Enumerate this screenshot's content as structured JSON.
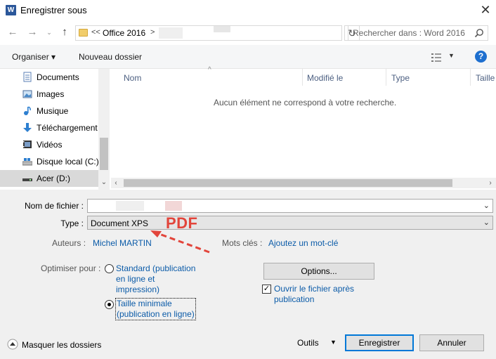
{
  "window": {
    "title": "Enregistrer sous",
    "app_icon_letter": "W"
  },
  "nav": {
    "address_prefix": "<<",
    "address_folder": "Office 2016",
    "address_chevron": ">",
    "search_placeholder": "Rechercher dans : Word 2016"
  },
  "toolbar": {
    "organize_label": "Organiser ▾",
    "new_folder_label": "Nouveau dossier"
  },
  "sidebar": {
    "items": [
      {
        "label": "Documents",
        "icon": "documents-icon",
        "selected": false
      },
      {
        "label": "Images",
        "icon": "images-icon",
        "selected": false
      },
      {
        "label": "Musique",
        "icon": "music-icon",
        "selected": false
      },
      {
        "label": "Téléchargement",
        "icon": "download-icon",
        "selected": false
      },
      {
        "label": "Vidéos",
        "icon": "videos-icon",
        "selected": false
      },
      {
        "label": "Disque local (C:)",
        "icon": "local-disk-icon",
        "selected": false
      },
      {
        "label": "Acer (D:)",
        "icon": "drive-icon",
        "selected": true
      }
    ]
  },
  "file_list": {
    "columns": [
      "Nom",
      "Modifié le",
      "Type",
      "Taille"
    ],
    "empty_message": "Aucun élément ne correspond à votre recherche."
  },
  "form": {
    "filename_label": "Nom de fichier :",
    "filename_value": "",
    "type_label": "Type :",
    "type_value": "Document XPS",
    "authors_label": "Auteurs :",
    "authors_value": "Michel MARTIN",
    "keywords_label": "Mots clés :",
    "keywords_value": "Ajoutez un mot-clé",
    "optimize_label": "Optimiser pour :",
    "option_standard_line1": "Standard (publication",
    "option_standard_line2": "en ligne et",
    "option_standard_line3": "impression)",
    "option_minimal_line1": "Taille minimale",
    "option_minimal_line2": "(publication en ligne)",
    "options_button": "Options...",
    "open_after_line1": "Ouvrir le fichier après",
    "open_after_line2": "publication",
    "open_after_checked": true
  },
  "annotation": {
    "text": "PDF",
    "color": "#e2453b"
  },
  "footer": {
    "hide_folders": "Masquer les dossiers",
    "tools": "Outils",
    "save": "Enregistrer",
    "cancel": "Annuler"
  },
  "colors": {
    "accent": "#0078d7",
    "link": "#0b5ba8",
    "word_blue": "#2b579a"
  }
}
